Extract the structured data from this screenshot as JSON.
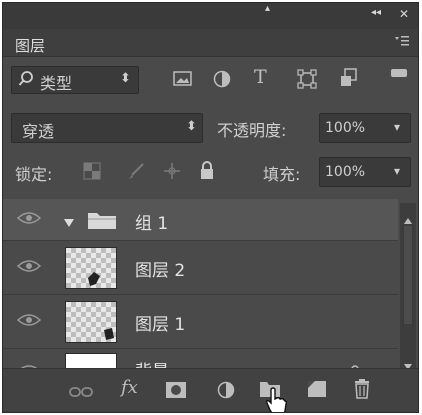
{
  "window": {
    "collapse_glyph": "◂◂",
    "close_glyph": "✕",
    "top_glyph": "▴"
  },
  "tab": {
    "label": "图层",
    "menu_icon": "panel-menu-icon"
  },
  "filter": {
    "search_icon": "search-icon",
    "kind_label": "类型",
    "kind_arrow": "⬍",
    "filter_icons": [
      "image-filter-icon",
      "adjustment-filter-icon",
      "type-filter-icon",
      "shape-filter-icon",
      "smart-object-filter-icon"
    ],
    "type_glyph": "T"
  },
  "blend": {
    "mode": "穿透",
    "mode_arrow": "⬍",
    "opacity_label": "不透明度:",
    "opacity_value": "100%",
    "opacity_arrow": "▾"
  },
  "lock": {
    "label": "锁定:",
    "icons": [
      "lock-transparent-icon",
      "lock-paint-icon",
      "lock-move-icon",
      "lock-all-icon"
    ],
    "fill_label": "填充:",
    "fill_value": "100%",
    "fill_arrow": "▾"
  },
  "layers": [
    {
      "name": "组 1",
      "type": "group",
      "expanded": true,
      "visible": true,
      "selected": true
    },
    {
      "name": "图层 2",
      "type": "layer",
      "visible": true,
      "indent": true
    },
    {
      "name": "图层 1",
      "type": "layer",
      "visible": true,
      "indent": true
    },
    {
      "name": "背景",
      "type": "layer",
      "visible": true,
      "partially_visible": true
    }
  ],
  "bottom_bar": {
    "icons": [
      "link-layers-icon",
      "fx-icon",
      "add-mask-icon",
      "adjustment-layer-icon",
      "new-group-icon",
      "new-layer-icon",
      "delete-layer-icon"
    ],
    "fx_label": "fx",
    "cursor_icon": "hand-pointer-icon"
  },
  "colors": {
    "panel_bg": "#4a4a4a",
    "selected_row": "#565656"
  }
}
